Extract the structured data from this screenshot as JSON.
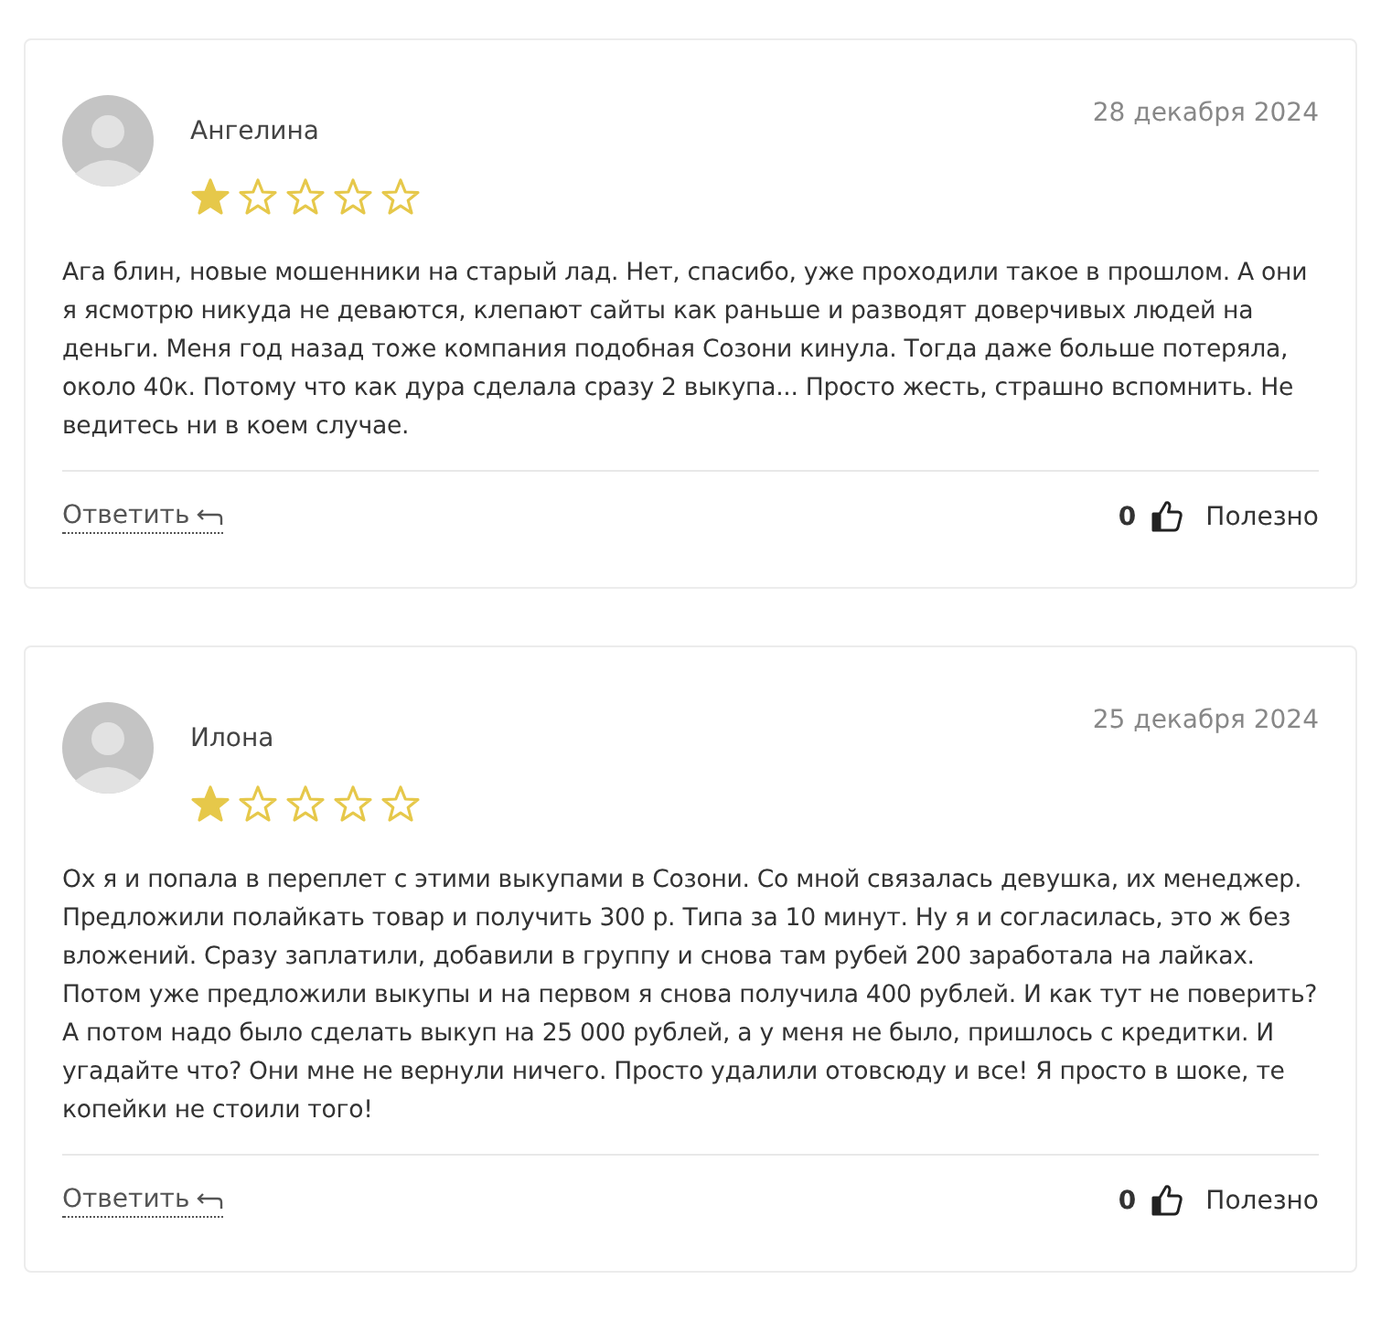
{
  "reviews": [
    {
      "author": "Ангелина",
      "date": "28 декабря 2024",
      "stars": 1,
      "text": "Ага блин, новые мошенники на старый лад. Нет, спасибо, уже проходили такое в прошлом. А они я ясмотрю никуда не деваются, клепают сайты как раньше и разводят доверчивых людей на деньги. Меня год назад тоже компания подобная Созони кинула. Тогда даже больше потеряла, около 40к. Потому что как дура сделала сразу 2 выкупа... Просто жесть, страшно вспомнить. Не ведитесь ни в коем случае.",
      "reply": "Ответить",
      "likes": "0",
      "useful": "Полезно"
    },
    {
      "author": "Илона",
      "date": "25 декабря 2024",
      "stars": 1,
      "text": "Ох я и попала в переплет с этими выкупами в Созони. Со мной связалась девушка, их менеджер. Предложили полайкать товар и получить 300 р. Типа за 10 минут. Ну я и согласилась, это ж без вложений. Сразу заплатили, добавили в группу и снова там рубей 200 заработала на лайках. Потом уже предложили выкупы и на первом я снова получила 400 рублей. И как тут не поверить? А потом надо было сделать выкуп на 25 000 рублей, а у меня не было, пришлось с кредитки. И угадайте что? Они мне не вернули ничего. Просто удалили отовсюду и все! Я просто в шоке, те копейки не стоили того!",
      "reply": "Ответить",
      "likes": "0",
      "useful": "Полезно"
    }
  ]
}
